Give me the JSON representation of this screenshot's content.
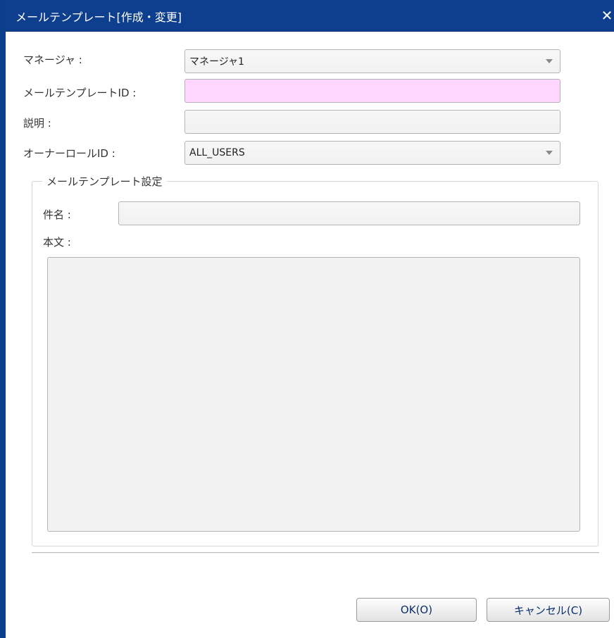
{
  "dialog": {
    "title": "メールテンプレート[作成・変更]",
    "close_symbol": "✕"
  },
  "form": {
    "manager": {
      "label": "マネージャ :",
      "value": "マネージャ1"
    },
    "template_id": {
      "label": "メールテンプレートID :",
      "value": ""
    },
    "description": {
      "label": "説明 :",
      "value": ""
    },
    "owner_role": {
      "label": "オーナーロールID :",
      "value": "ALL_USERS"
    }
  },
  "settings": {
    "legend": "メールテンプレート設定",
    "subject": {
      "label": "件名 :",
      "value": ""
    },
    "body": {
      "label": "本文 :",
      "value": ""
    }
  },
  "buttons": {
    "ok": "OK(O)",
    "cancel": "キャンセル(C)"
  },
  "colors": {
    "titlebar": "#0d3f8e",
    "required_field": "#ffd6ff"
  }
}
